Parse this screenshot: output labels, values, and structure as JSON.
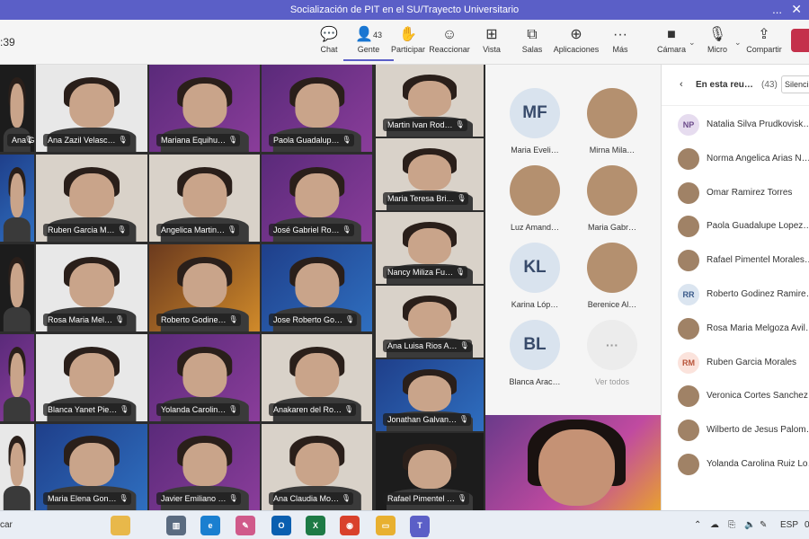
{
  "window": {
    "title": "Socialización de PIT en el SU/Trayecto Universitario",
    "more": "...",
    "close": "✕"
  },
  "toolbar": {
    "timer": ":39",
    "buttons": [
      {
        "label": "Chat",
        "icon": "chat-icon"
      },
      {
        "label": "Gente",
        "icon": "people-icon",
        "count": "43"
      },
      {
        "label": "Participar",
        "icon": "raise-hand-icon"
      },
      {
        "label": "Reaccionar",
        "icon": "emoji-icon"
      },
      {
        "label": "Vista",
        "icon": "grid-view-icon"
      },
      {
        "label": "Salas",
        "icon": "breakout-rooms-icon"
      },
      {
        "label": "Aplicaciones",
        "icon": "apps-icon"
      },
      {
        "label": "Más",
        "icon": "more-icon"
      },
      {
        "label": "Cámara",
        "icon": "camera-icon"
      },
      {
        "label": "Micro",
        "icon": "microphone-icon"
      },
      {
        "label": "Compartir",
        "icon": "share-icon"
      }
    ]
  },
  "video_grid": [
    {
      "name": "Ana G…",
      "bg": "bg-dark"
    },
    {
      "name": "Ana Zazil Velasc…",
      "bg": "bg-white"
    },
    {
      "name": "Mariana Equihu…",
      "bg": "bg-purple"
    },
    {
      "name": "Paola Guadalup…",
      "bg": "bg-purple"
    },
    {
      "name": "Martin Ivan Rod…",
      "bg": "bg-wall"
    },
    {
      "name": "",
      "bg": "bg-blue"
    },
    {
      "name": "Ruben Garcia M…",
      "bg": "bg-wall"
    },
    {
      "name": "Angelica Martin…",
      "bg": "bg-wall"
    },
    {
      "name": "José Gabriel Ro…",
      "bg": "bg-purple"
    },
    {
      "name": "Maria Teresa Bri…",
      "bg": "bg-wall"
    },
    {
      "name": "",
      "bg": "bg-dark"
    },
    {
      "name": "Rosa Maria Mel…",
      "bg": "bg-white"
    },
    {
      "name": "Roberto Godine…",
      "bg": "bg-orange"
    },
    {
      "name": "Jose Roberto Go…",
      "bg": "bg-blue"
    },
    {
      "name": "Nancy Miliza Fu…",
      "bg": "bg-wall"
    },
    {
      "name": "",
      "bg": "bg-purple"
    },
    {
      "name": "Blanca Yanet Pie…",
      "bg": "bg-white"
    },
    {
      "name": "Yolanda Carolin…",
      "bg": "bg-purple"
    },
    {
      "name": "Anakaren del Ro…",
      "bg": "bg-wall"
    },
    {
      "name": "Ana Luisa Rios A…",
      "bg": "bg-wall"
    },
    {
      "name": "",
      "bg": "bg-white"
    },
    {
      "name": "Maria Elena Gon…",
      "bg": "bg-blue"
    },
    {
      "name": "Javier Emiliano …",
      "bg": "bg-purple"
    },
    {
      "name": "Ana Claudia Mo…",
      "bg": "bg-wall"
    },
    {
      "name": "Jonathan Galvan…",
      "bg": "bg-blue"
    },
    {
      "name": "Rafael Pimentel …",
      "bg": "bg-dark"
    }
  ],
  "avatar_grid": [
    {
      "initials": "MF",
      "name": "Maria Eveli…"
    },
    {
      "initials": "",
      "name": "Mirna Mila…"
    },
    {
      "initials": "",
      "name": "Luz Amand…"
    },
    {
      "initials": "",
      "name": "Maria Gabr…"
    },
    {
      "initials": "KL",
      "name": "Karina Lóp…"
    },
    {
      "initials": "",
      "name": "Berenice Al…"
    },
    {
      "initials": "BL",
      "name": "Blanca Arac…"
    },
    {
      "initials": "···",
      "name": "Ver todos"
    }
  ],
  "panel": {
    "back": "‹",
    "title": "En esta reu…",
    "count": "(43)",
    "mute_all": "Silenci…",
    "people": [
      {
        "initials": "NP",
        "cls": "i-np",
        "name": "Natalia Silva Prudkovisk…"
      },
      {
        "initials": "",
        "cls": "",
        "name": "Norma Angelica Arias N…"
      },
      {
        "initials": "",
        "cls": "",
        "name": "Omar Ramirez Torres"
      },
      {
        "initials": "",
        "cls": "",
        "name": "Paola Guadalupe Lopez…"
      },
      {
        "initials": "",
        "cls": "",
        "name": "Rafael Pimentel Morales…"
      },
      {
        "initials": "RR",
        "cls": "i-rr",
        "name": "Roberto Godinez Ramire…"
      },
      {
        "initials": "",
        "cls": "",
        "name": "Rosa Maria Melgoza Avil…"
      },
      {
        "initials": "RM",
        "cls": "i-rm",
        "name": "Ruben Garcia Morales"
      },
      {
        "initials": "",
        "cls": "",
        "name": "Veronica Cortes Sanchez…"
      },
      {
        "initials": "",
        "cls": "",
        "name": "Wilberto de Jesus Palom…"
      },
      {
        "initials": "",
        "cls": "",
        "name": "Yolanda Carolina Ruiz Lo…"
      }
    ]
  },
  "taskbar": {
    "search": "car",
    "apps": [
      {
        "name": "files-icon",
        "glyph": "",
        "color": "#e8b84a"
      },
      {
        "name": "task-view-icon",
        "glyph": "▥",
        "color": "#5a6b80"
      },
      {
        "name": "edge-icon",
        "glyph": "e",
        "color": "#1a7fd0"
      },
      {
        "name": "paint-icon",
        "glyph": "✎",
        "color": "#d05a8a"
      },
      {
        "name": "outlook-icon",
        "glyph": "O",
        "color": "#0a5fb0"
      },
      {
        "name": "excel-icon",
        "glyph": "X",
        "color": "#1d7a45"
      },
      {
        "name": "chrome-icon",
        "glyph": "◉",
        "color": "#d9412b"
      },
      {
        "name": "file-explorer-icon",
        "glyph": "▭",
        "color": "#e8b030"
      },
      {
        "name": "teams-icon",
        "glyph": "T",
        "color": "#5b5fc7"
      }
    ],
    "lang": "ESP",
    "clock": "0"
  }
}
